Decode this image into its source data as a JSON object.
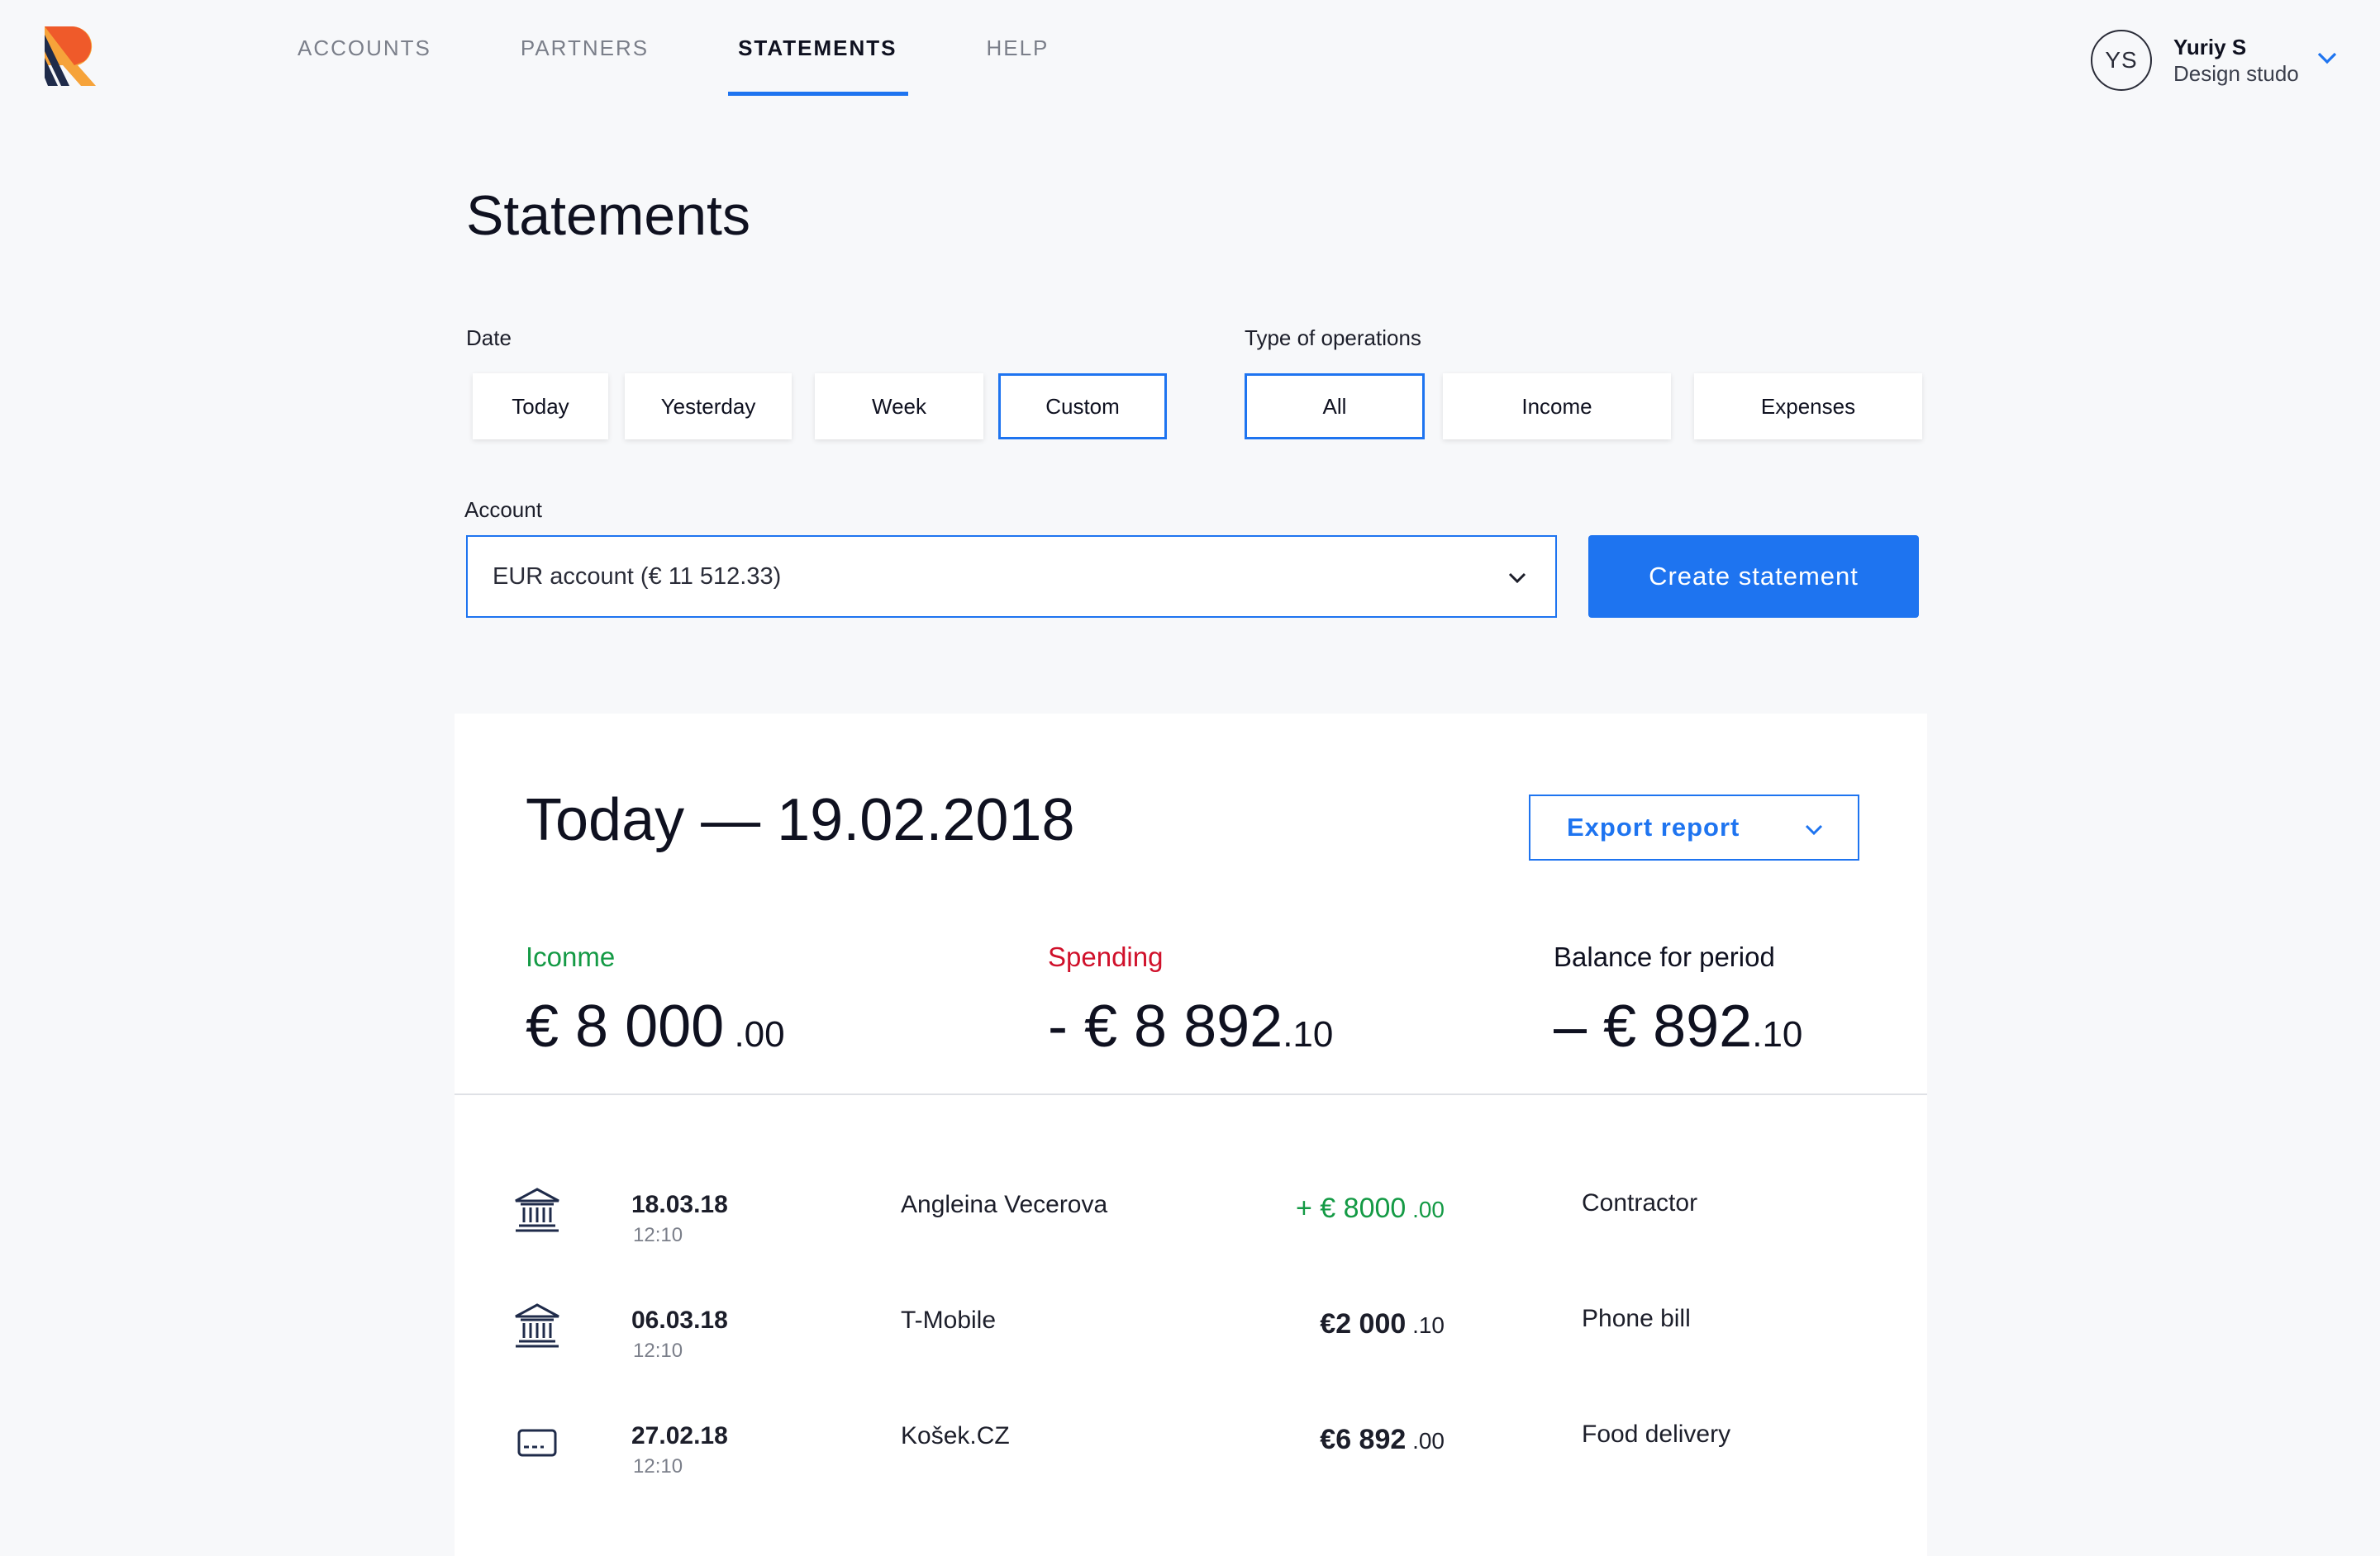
{
  "nav": {
    "items": [
      {
        "label": "ACCOUNTS",
        "active": false
      },
      {
        "label": "PARTNERS",
        "active": false
      },
      {
        "label": "STATEMENTS",
        "active": true
      },
      {
        "label": "HELP",
        "active": false
      }
    ]
  },
  "user": {
    "initials": "YS",
    "name": "Yuriy S",
    "company": "Design studo"
  },
  "page": {
    "title": "Statements"
  },
  "filters": {
    "date_label": "Date",
    "date_options": [
      {
        "label": "Today",
        "selected": false
      },
      {
        "label": "Yesterday",
        "selected": false
      },
      {
        "label": "Week",
        "selected": false
      },
      {
        "label": "Custom",
        "selected": true
      }
    ],
    "type_label": "Type of operations",
    "type_options": [
      {
        "label": "All",
        "selected": true
      },
      {
        "label": "Income",
        "selected": false
      },
      {
        "label": "Expenses",
        "selected": false
      }
    ],
    "account_label": "Account",
    "account_value": "EUR account (€ 11 512.33)",
    "create_button": "Create statement"
  },
  "report": {
    "title": "Today — 19.02.2018",
    "export_button": "Export report",
    "income": {
      "label": "Iconme",
      "value": "€ 8 000",
      "cents": " .00"
    },
    "spending": {
      "label": "Spending",
      "value": "- € 8 892",
      "cents": ".10"
    },
    "balance": {
      "label": "Balance for period",
      "value": "– € 892",
      "cents": ".10"
    }
  },
  "transactions": [
    {
      "icon": "bank-icon",
      "date": "18.03.18",
      "time": "12:10",
      "name": "Angleina Vecerova",
      "amount": "+ € 8000",
      "cents": " .00",
      "incoming": true,
      "category": "Contractor"
    },
    {
      "icon": "bank-icon",
      "date": "06.03.18",
      "time": "12:10",
      "name": "T-Mobile",
      "amount": "€2 000",
      "cents": " .10",
      "incoming": false,
      "category": "Phone bill"
    },
    {
      "icon": "card-icon",
      "date": "27.02.18",
      "time": "12:10",
      "name": "Košek.CZ",
      "amount": "€6 892",
      "cents": " .00",
      "incoming": false,
      "category": "Food delivery"
    }
  ],
  "colors": {
    "accent": "#1e74f0",
    "income": "#149a45",
    "spending": "#d0112b"
  }
}
